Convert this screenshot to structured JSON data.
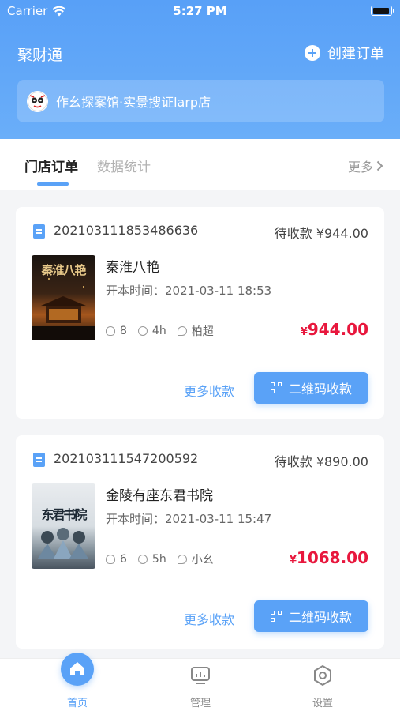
{
  "status_bar": {
    "carrier": "Carrier",
    "time": "5:27 PM"
  },
  "header": {
    "app_title": "聚财通",
    "create_order_label": "创建订单",
    "store_name": "作幺探案馆·实景搜证larp店"
  },
  "tabs": {
    "items": [
      {
        "label": "门店订单",
        "active": true
      },
      {
        "label": "数据统计",
        "active": false
      }
    ],
    "more_label": "更多"
  },
  "orders": [
    {
      "order_no": "202103111853486636",
      "pending_label": "待收款 ¥944.00",
      "poster_text": "秦淮八艳",
      "title": "秦淮八艳",
      "start_time": "开本时间：2021-03-11 18:53",
      "players": "8",
      "duration": "4h",
      "host": "柏超",
      "price_symbol": "¥",
      "price": "944.00",
      "more_pay_label": "更多收款",
      "qr_label": "二维码收款"
    },
    {
      "order_no": "202103111547200592",
      "pending_label": "待收款 ¥890.00",
      "poster_text": "东君书院",
      "title": "金陵有座东君书院",
      "start_time": "开本时间：2021-03-11 15:47",
      "players": "6",
      "duration": "5h",
      "host": "小幺",
      "price_symbol": "¥",
      "price": "1068.00",
      "more_pay_label": "更多收款",
      "qr_label": "二维码收款"
    }
  ],
  "tabbar": {
    "items": [
      {
        "label": "首页",
        "icon": "home-icon",
        "active": true
      },
      {
        "label": "管理",
        "icon": "manage-icon",
        "active": false
      },
      {
        "label": "设置",
        "icon": "settings-icon",
        "active": false
      }
    ]
  },
  "colors": {
    "accent": "#5aa2f7",
    "price": "#e8173d",
    "header_bg": "#58a0f7"
  }
}
